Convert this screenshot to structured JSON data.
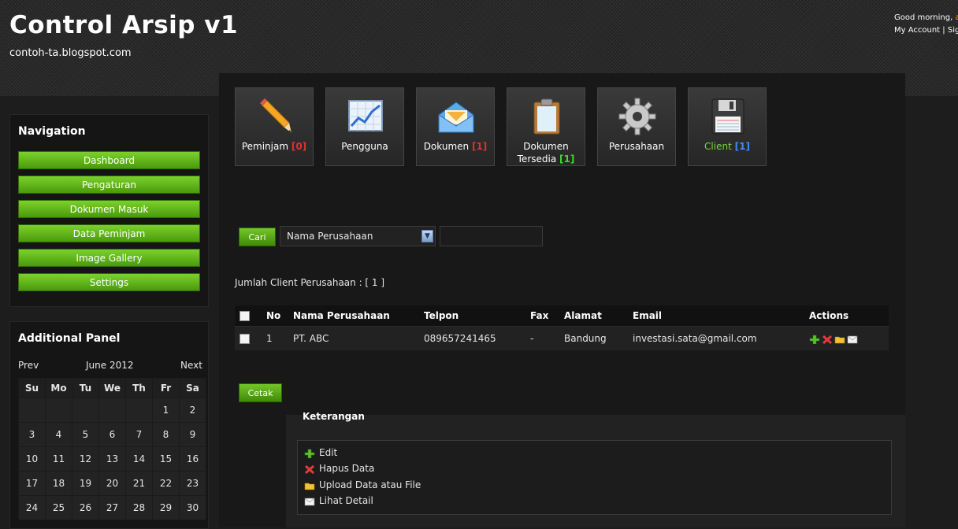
{
  "header": {
    "title": "Control Arsip v1",
    "subtitle": "contoh-ta.blogspot.com",
    "greeting": "Good morning,",
    "username": "a",
    "my_account": "My Account",
    "separator": "|",
    "sign_out": "Sig"
  },
  "nav": {
    "title": "Navigation",
    "items": [
      "Dashboard",
      "Pengaturan",
      "Dokumen Masuk",
      "Data Peminjam",
      "Image Gallery",
      "Settings"
    ]
  },
  "additional": {
    "title": "Additional Panel",
    "prev": "Prev",
    "month": "June 2012",
    "next": "Next",
    "weekdays": [
      "Su",
      "Mo",
      "Tu",
      "We",
      "Th",
      "Fr",
      "Sa"
    ],
    "weeks": [
      [
        "",
        "",
        "",
        "",
        "",
        "1",
        "2"
      ],
      [
        "3",
        "4",
        "5",
        "6",
        "7",
        "8",
        "9"
      ],
      [
        "10",
        "11",
        "12",
        "13",
        "14",
        "15",
        "16"
      ],
      [
        "17",
        "18",
        "19",
        "20",
        "21",
        "22",
        "23"
      ],
      [
        "24",
        "25",
        "26",
        "27",
        "28",
        "29",
        "30"
      ]
    ]
  },
  "tiles": [
    {
      "label": "Peminjam",
      "count": "[0]",
      "icon": "pencil-icon"
    },
    {
      "label": "Pengguna",
      "count": "",
      "icon": "chart-icon"
    },
    {
      "label": "Dokumen",
      "count": "[1]",
      "icon": "mail-icon"
    },
    {
      "label_line1": "Dokumen",
      "label_line2": "Tersedia",
      "count": "[1]",
      "icon": "clipboard-icon"
    },
    {
      "label": "Perusahaan",
      "count": "",
      "icon": "gear-icon"
    },
    {
      "label": "Client",
      "count": "[1]",
      "icon": "floppy-disk-icon"
    }
  ],
  "search": {
    "button": "Cari",
    "selected": "Nama Perusahaan",
    "value": ""
  },
  "count_line": "Jumlah Client Perusahaan : [ 1 ]",
  "table": {
    "headers": [
      "No",
      "Nama Perusahaan",
      "Telpon",
      "Fax",
      "Alamat",
      "Email",
      "Actions"
    ],
    "rows": [
      {
        "no": "1",
        "nama": "PT. ABC",
        "telpon": "089657241465",
        "fax": "-",
        "alamat": "Bandung",
        "email": "investasi.sata@gmail.com"
      }
    ]
  },
  "print_button": "Cetak",
  "legend": {
    "title": "Keterangan",
    "items": [
      "Edit",
      "Hapus Data",
      "Upload Data atau File",
      "Lihat Detail"
    ]
  },
  "colors": {
    "accent_green": "#5aae14",
    "count_red": "#e23030",
    "count_green": "#3ddc2c",
    "count_blue": "#3b8cff"
  }
}
